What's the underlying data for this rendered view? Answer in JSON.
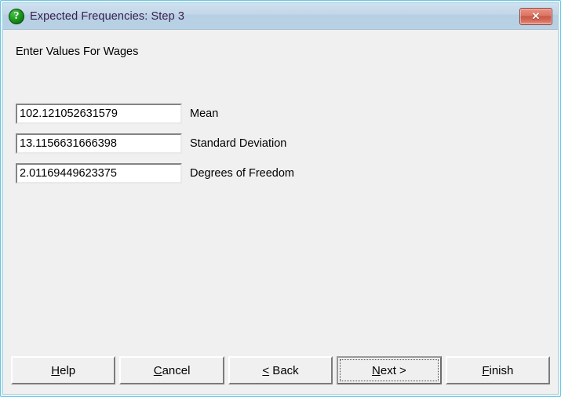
{
  "window": {
    "title": "Expected Frequencies: Step 3",
    "title_icon": "question-mark-icon",
    "close_label": "✕",
    "accent_titlebar_color": "#b9d1e4",
    "title_text_color": "#3b1d4e",
    "close_button_color": "#c75747",
    "frame_color": "#5ec8ea",
    "client_background": "#f0f0f0"
  },
  "form": {
    "prompt": "Enter Values For Wages",
    "fields": [
      {
        "value": "102.121052631579",
        "label": "Mean",
        "placeholder": ""
      },
      {
        "value": "13.1156631666398",
        "label": "Standard Deviation",
        "placeholder": ""
      },
      {
        "value": "2.01169449623375",
        "label": "Degrees of Freedom",
        "placeholder": ""
      }
    ]
  },
  "buttons": [
    {
      "id": "help",
      "pre": "",
      "accel": "H",
      "post": "elp",
      "default": false
    },
    {
      "id": "cancel",
      "pre": "",
      "accel": "C",
      "post": "ancel",
      "default": false
    },
    {
      "id": "back",
      "pre": "",
      "accel": "<",
      "post": " Back",
      "default": false
    },
    {
      "id": "next",
      "pre": "",
      "accel": "N",
      "post": "ext >",
      "default": true
    },
    {
      "id": "finish",
      "pre": "",
      "accel": "F",
      "post": "inish",
      "default": false
    }
  ]
}
